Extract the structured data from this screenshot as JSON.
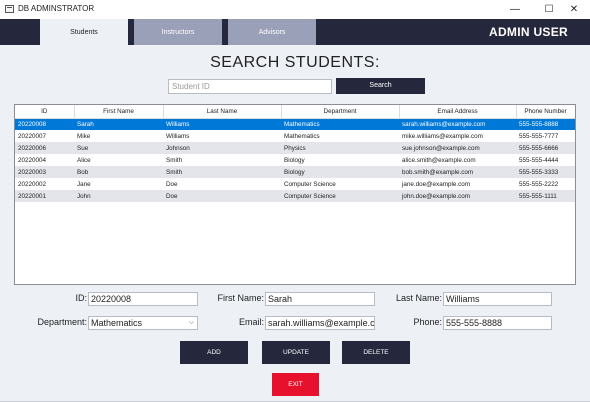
{
  "window": {
    "title": "DB ADMINSTRATOR",
    "minimize": "—",
    "maximize": "☐",
    "close": "✕"
  },
  "header": {
    "tabs": [
      {
        "label": "Students"
      },
      {
        "label": "Instructors"
      },
      {
        "label": "Advisors"
      }
    ],
    "user": "ADMIN USER"
  },
  "search": {
    "title": "SEARCH STUDENTS:",
    "placeholder": "Student ID",
    "button": "Search"
  },
  "table": {
    "columns": [
      "ID",
      "First Name",
      "Last Name",
      "Department",
      "Email Address",
      "Phone Number"
    ],
    "rows": [
      [
        "20220008",
        "Sarah",
        "Williams",
        "Mathematics",
        "sarah.williams@example.com",
        "555-555-8888"
      ],
      [
        "20220007",
        "Mike",
        "Williams",
        "Mathematics",
        "mike.williams@example.com",
        "555-555-7777"
      ],
      [
        "20220006",
        "Sue",
        "Johnson",
        "Physics",
        "sue.johnson@example.com",
        "555-555-6666"
      ],
      [
        "20220004",
        "Alice",
        "Smith",
        "Biology",
        "alice.smith@example.com",
        "555-555-4444"
      ],
      [
        "20220003",
        "Bob",
        "Smith",
        "Biology",
        "bob.smith@example.com",
        "555-555-3333"
      ],
      [
        "20220002",
        "Jane",
        "Doe",
        "Computer Science",
        "jane.doe@example.com",
        "555-555-2222"
      ],
      [
        "20220001",
        "John",
        "Doe",
        "Computer Science",
        "john.doe@example.com",
        "555-555-1111"
      ]
    ],
    "selected_index": 0
  },
  "form": {
    "id_label": "ID:",
    "id_value": "20220008",
    "first_name_label": "First Name:",
    "first_name_value": "Sarah",
    "last_name_label": "Last Name:",
    "last_name_value": "Williams",
    "department_label": "Department:",
    "department_value": "Mathematics",
    "email_label": "Email:",
    "email_value": "sarah.williams@example.c",
    "phone_label": "Phone:",
    "phone_value": "555-555-8888"
  },
  "actions": {
    "add": "ADD",
    "update": "UPDATE",
    "delete": "DELETE",
    "exit": "EXIT"
  },
  "colors": {
    "header_bg": "#25273d",
    "tab_inactive": "#9ba0b9",
    "content_bg": "#edf1f6",
    "selection": "#0078d7",
    "exit": "#e8112d"
  }
}
